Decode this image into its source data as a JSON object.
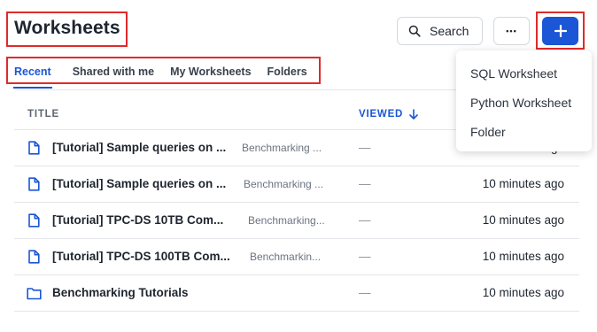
{
  "header": {
    "title": "Worksheets",
    "search_label": "Search",
    "more_label": "•••",
    "add_label": "+"
  },
  "tabs": [
    {
      "label": "Recent",
      "active": true
    },
    {
      "label": "Shared with me",
      "active": false
    },
    {
      "label": "My Worksheets",
      "active": false
    },
    {
      "label": "Folders",
      "active": false
    }
  ],
  "table": {
    "columns": {
      "title": "TITLE",
      "viewed": "VIEWED"
    },
    "rows": [
      {
        "icon": "file-icon",
        "name": "[Tutorial] Sample queries on ...",
        "location": "Benchmarking ...",
        "viewed": "—",
        "time": "10 minutes ago"
      },
      {
        "icon": "file-icon",
        "name": "[Tutorial] Sample queries on ...",
        "location": "Benchmarking ...",
        "viewed": "—",
        "time": "10 minutes ago"
      },
      {
        "icon": "file-icon",
        "name": "[Tutorial] TPC-DS 10TB Com...",
        "location": "Benchmarking...",
        "viewed": "—",
        "time": "10 minutes ago"
      },
      {
        "icon": "file-icon",
        "name": "[Tutorial] TPC-DS 100TB Com...",
        "location": "Benchmarkin...",
        "viewed": "—",
        "time": "10 minutes ago"
      },
      {
        "icon": "folder-icon",
        "name": "Benchmarking Tutorials",
        "location": "",
        "viewed": "—",
        "time": "10 minutes ago"
      }
    ]
  },
  "add_menu": {
    "items": [
      "SQL Worksheet",
      "Python Worksheet",
      "Folder"
    ]
  },
  "colors": {
    "accent": "#1a56d6",
    "highlight": "#e02a2a"
  }
}
